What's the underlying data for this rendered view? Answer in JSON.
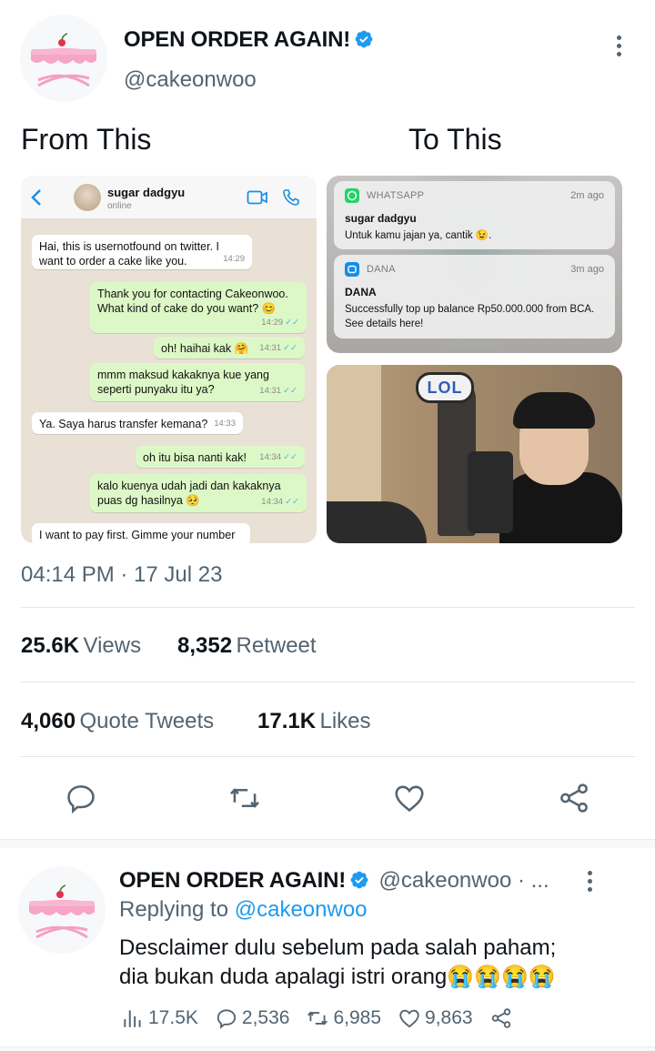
{
  "tweet": {
    "author_name": "OPEN ORDER AGAIN!",
    "handle": "@cakeonwoo",
    "label_left": "From This",
    "label_right": "To This",
    "timestamp": "04:14 PM · 17 Jul 23",
    "stats": {
      "views_num": "25.6K",
      "views_lbl": "Views",
      "retweet_num": "8,352",
      "retweet_lbl": "Retweet",
      "quote_num": "4,060",
      "quote_lbl": "Quote Tweets",
      "likes_num": "17.1K",
      "likes_lbl": "Likes"
    }
  },
  "chat": {
    "contact": "sugar dadgyu",
    "status": "online",
    "messages": [
      {
        "dir": "in",
        "text": "Hai, this is usernotfound on twitter. I want to order a cake like you.",
        "time": "14:29"
      },
      {
        "dir": "out",
        "text": "Thank you for contacting Cakeonwoo. What kind of cake do you want? 😊",
        "time": "14:29"
      },
      {
        "dir": "out",
        "text": "oh! haihai kak 🤗",
        "time": "14:31"
      },
      {
        "dir": "out",
        "text": "mmm maksud kakaknya kue yang seperti punyaku itu ya?",
        "time": "14:31"
      },
      {
        "dir": "in",
        "text": "Ya. Saya harus transfer kemana?",
        "time": "14:33"
      },
      {
        "dir": "out",
        "text": "oh itu bisa nanti kak!",
        "time": "14:34"
      },
      {
        "dir": "out",
        "text": "kalo kuenya udah jadi dan kakaknya puas dg hasilnya 🥺",
        "time": "14:34"
      },
      {
        "dir": "in",
        "text": "I want to pay first. Gimme your number",
        "time": ""
      }
    ]
  },
  "notifications": [
    {
      "app": "WHATSAPP",
      "ago": "2m ago",
      "title": "sugar dadgyu",
      "body": "Untuk kamu jajan ya, cantik 😉."
    },
    {
      "app": "DANA",
      "ago": "3m ago",
      "title": "DANA",
      "body": "Successfully top up balance Rp50.000.000 from BCA. See details here!"
    }
  ],
  "photo": {
    "sticker": "LOL"
  },
  "reply": {
    "author_name": "OPEN ORDER AGAIN!",
    "handle": "@cakeonwoo · ...",
    "replying_prefix": "Replying to",
    "replying_handle": "@cakeonwoo",
    "line1": "Desclaimer dulu sebelum pada salah paham;",
    "line2": "dia bukan duda apalagi istri orang😭😭😭😭",
    "views": "17.5K",
    "replies": "2,536",
    "retweets": "6,985",
    "likes": "9,863"
  },
  "colors": {
    "accent": "#1d9bf0",
    "secondary_text": "#536471",
    "avatar_pink": "#f7a8c8"
  },
  "icons": [
    "verified-icon",
    "more-icon",
    "reply-icon",
    "retweet-icon",
    "like-icon",
    "share-icon",
    "views-icon",
    "back-icon",
    "video-call-icon",
    "phone-icon"
  ]
}
